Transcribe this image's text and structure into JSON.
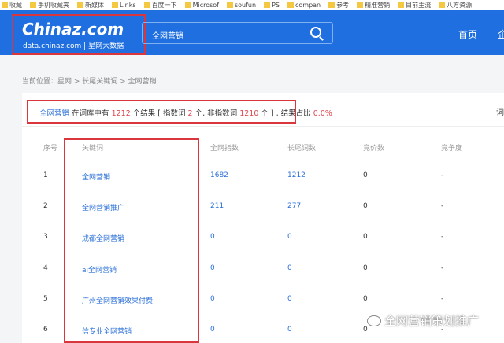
{
  "bookmarks": [
    "收藏",
    "手机收藏夹",
    "新媒体",
    "Links",
    "百度一下",
    "Microsof",
    "soufun",
    "PS",
    "compan",
    "参考",
    "精准营销",
    "目前主流",
    "八方资源"
  ],
  "header": {
    "logo": "Chinaz.com",
    "logo_sub": "data.chinaz.com | 星网大数据",
    "search_value": "全网营销",
    "nav": [
      "首页",
      "企"
    ]
  },
  "breadcrumb": "当前位置：星网 > 长尾关键词 > 全网营销",
  "summary": {
    "kw": "全网营销",
    "t1": " 在词库中有 ",
    "total": "1212",
    "t2": " 个结果 [ 指数词 ",
    "idx": "2",
    "t3": " 个, 非指数词 ",
    "nonidx": "1210",
    "t4": " 个 ] , 结果占比 ",
    "ratio": "0.0%",
    "right": "词"
  },
  "table": {
    "headers": [
      "序号",
      "关键词",
      "全网指数",
      "长尾词数",
      "竞价数",
      "竞争度"
    ],
    "rows": [
      [
        "1",
        "全网营销",
        "1682",
        "1212",
        "0",
        "-"
      ],
      [
        "2",
        "全网营销推广",
        "211",
        "277",
        "0",
        "-"
      ],
      [
        "3",
        "成都全网营销",
        "0",
        "0",
        "0",
        "-"
      ],
      [
        "4",
        "ai全网营销",
        "0",
        "0",
        "0",
        "-"
      ],
      [
        "5",
        "广州全网营销效果付费",
        "0",
        "0",
        "0",
        "-"
      ],
      [
        "6",
        "信专业全网营销",
        "0",
        "0",
        "0",
        "-"
      ]
    ]
  },
  "watermark": "全网营销策划推广",
  "colors": {
    "header": "#1f6fe0",
    "link": "#2a6fd8",
    "highlight": "#e0454e",
    "annotation": "#d9363e"
  }
}
